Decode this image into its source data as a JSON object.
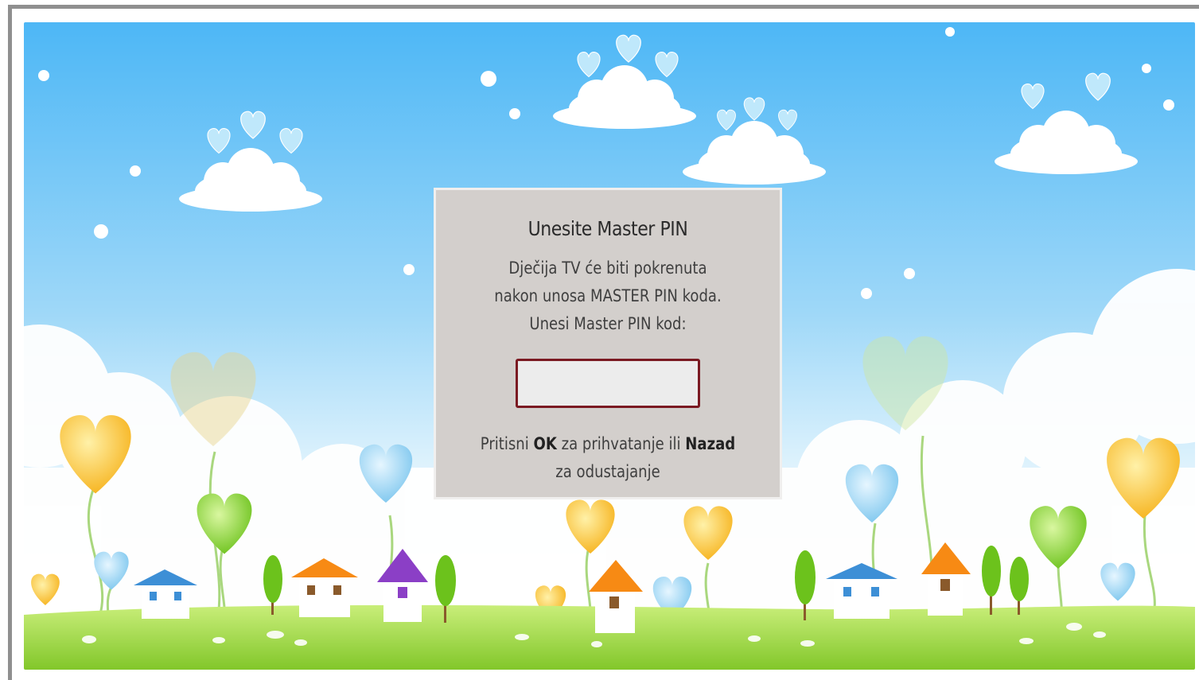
{
  "dialog": {
    "title": "Unesite Master PIN",
    "message": "Dječija TV će biti pokrenuta nakon unosa MASTER PIN koda. Unesi Master PIN kod:",
    "pin_value": "",
    "hint_prefix": "Pritisni",
    "hint_ok_key": "OK",
    "hint_middle": "za prihvatanje ili",
    "hint_back_key": "Nazad",
    "hint_suffix": "za odustajanje"
  },
  "background": {
    "icons": [
      "cloud-icon",
      "heart-flower-icon",
      "house-icon",
      "tree-icon",
      "star-dot-icon"
    ],
    "sky_top": "#4fb8f5",
    "sky_bottom": "#d8f0fc",
    "grass": "#9ad83a"
  }
}
